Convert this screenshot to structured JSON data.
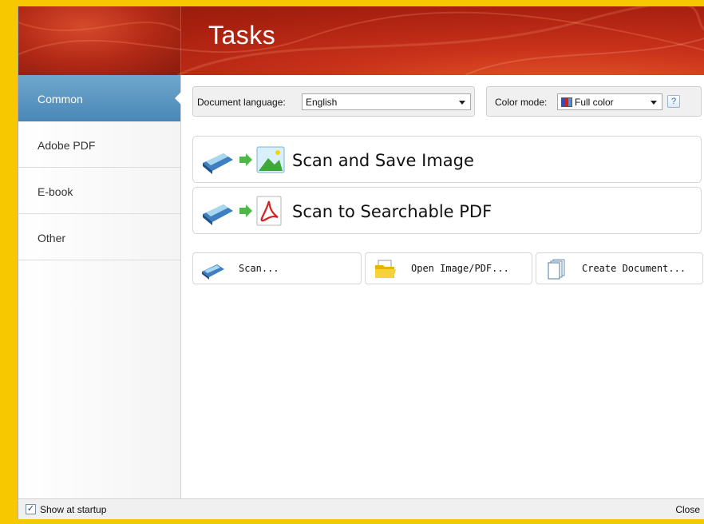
{
  "header": {
    "title": "Tasks"
  },
  "sidebar": {
    "items": [
      {
        "label": "Common",
        "active": true
      },
      {
        "label": "Adobe PDF",
        "active": false
      },
      {
        "label": "E-book",
        "active": false
      },
      {
        "label": "Other",
        "active": false
      }
    ]
  },
  "options": {
    "language_label": "Document language:",
    "language_value": "English",
    "color_label": "Color mode:",
    "color_value": "Full color",
    "help_label": "?"
  },
  "tasks": {
    "big": [
      {
        "label": "Scan and Save Image",
        "icon": "scan-to-image-icon"
      },
      {
        "label": "Scan to Searchable PDF",
        "icon": "scan-to-pdf-icon"
      }
    ],
    "small": [
      {
        "label": "Scan...",
        "icon": "scanner-icon"
      },
      {
        "label": "Open Image/PDF...",
        "icon": "open-folder-icon"
      },
      {
        "label": "Create Document...",
        "icon": "document-icon"
      }
    ]
  },
  "footer": {
    "show_at_startup_label": "Show at startup",
    "show_at_startup_checked": true,
    "close_label": "Close"
  },
  "colors": {
    "accent": "#4a88b8",
    "header": "#b32a16",
    "background": "#f7c800"
  }
}
